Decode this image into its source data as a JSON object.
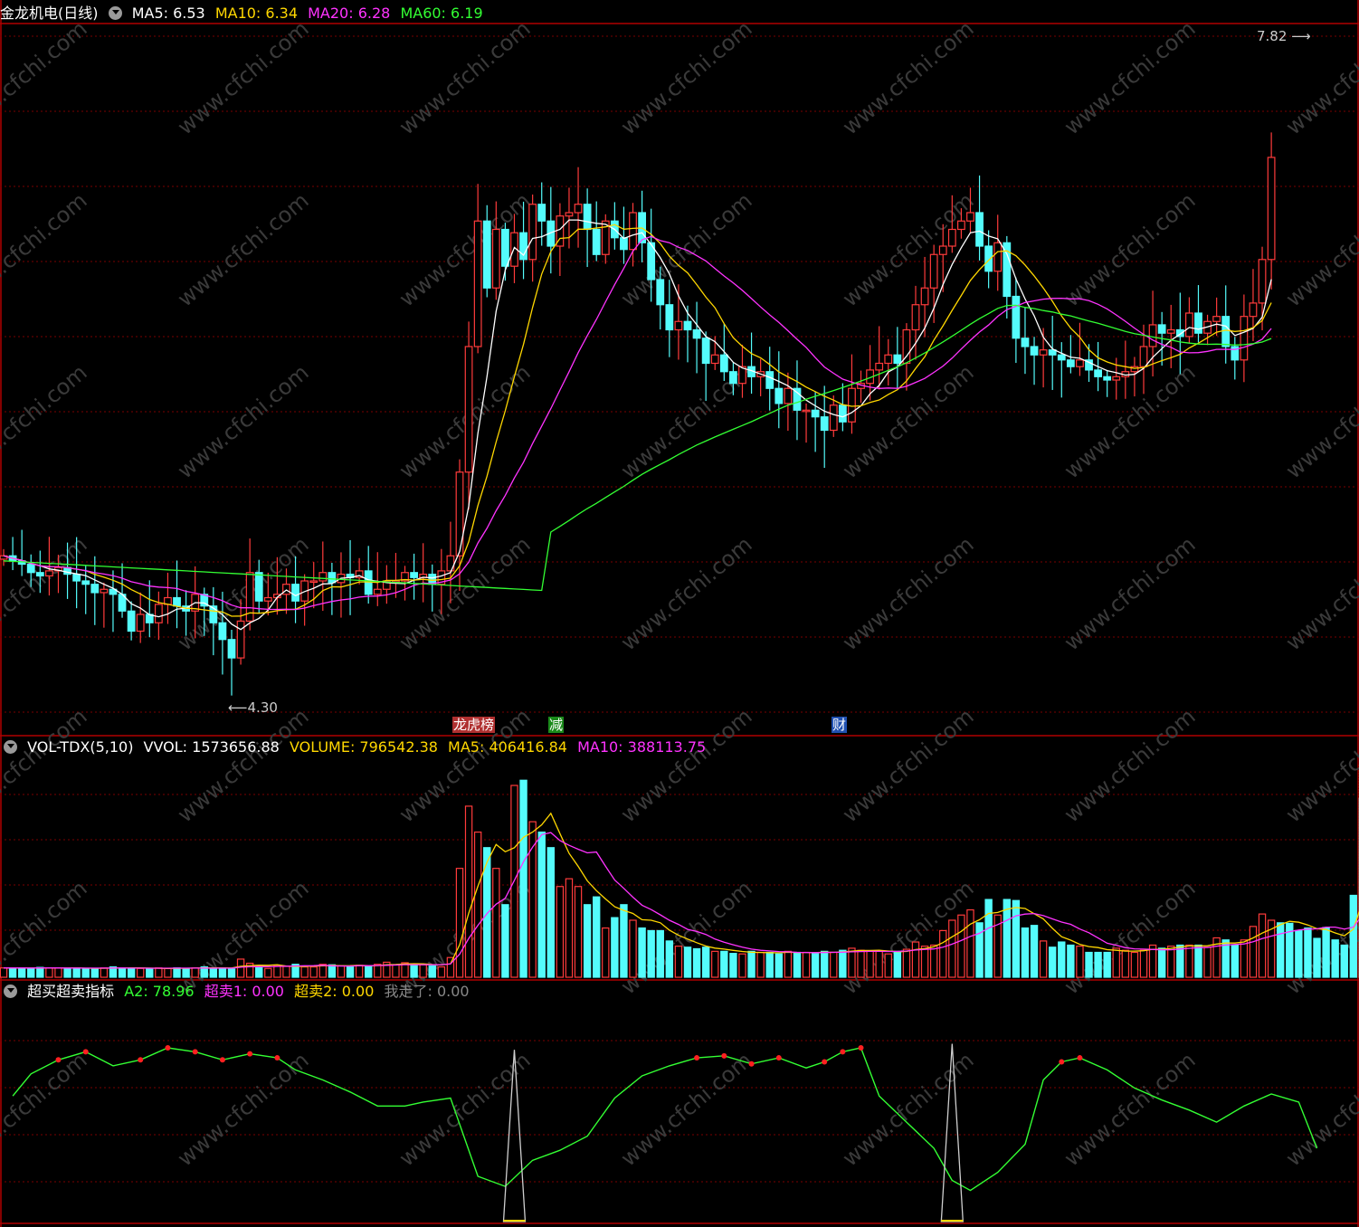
{
  "header": {
    "stock_name": "金龙机电(日线)",
    "ma_labels": [
      {
        "text": "MA5: 6.53",
        "color": "#ffffff"
      },
      {
        "text": "MA10: 6.34",
        "color": "#ffd700"
      },
      {
        "text": "MA20: 6.28",
        "color": "#ff33ff"
      },
      {
        "text": "MA60: 6.19",
        "color": "#33ff33"
      }
    ]
  },
  "price_annotations": {
    "high": "7.82",
    "low": "4.30"
  },
  "event_tags": [
    {
      "text": "龙虎榜",
      "color": "#b03030"
    },
    {
      "text": "减",
      "color": "#1a8a1a"
    },
    {
      "text": "财",
      "color": "#2050b0"
    }
  ],
  "volume_header": {
    "title": "VOL-TDX(5,10)",
    "values": [
      {
        "text": "VVOL: 1573656.88",
        "color": "#ffffff"
      },
      {
        "text": "VOLUME: 796542.38",
        "color": "#ffd700"
      },
      {
        "text": "MA5: 406416.84",
        "color": "#ffd700"
      },
      {
        "text": "MA10: 388113.75",
        "color": "#ff33ff"
      }
    ]
  },
  "indicator_header": {
    "title": "超买超卖指标",
    "values": [
      {
        "text": "A2: 78.96",
        "color": "#33ff33"
      },
      {
        "text": "超卖1: 0.00",
        "color": "#ff33ff"
      },
      {
        "text": "超卖2: 0.00",
        "color": "#ffd700"
      },
      {
        "text": "我走了: 0.00",
        "color": "#888888"
      }
    ]
  },
  "colors": {
    "up": "#ff3b3b",
    "down": "#54fcfc",
    "ma5": "#ffffff",
    "ma10": "#ffd700",
    "ma20": "#ff33ff",
    "ma60": "#33ff33",
    "grid": "#7a0000",
    "border": "#b00000"
  },
  "chart_data": {
    "type": "candlestick",
    "ylim": [
      4.0,
      8.0
    ],
    "closes": [
      4.95,
      4.92,
      4.9,
      4.85,
      4.83,
      4.86,
      4.88,
      4.84,
      4.8,
      4.78,
      4.73,
      4.75,
      4.72,
      4.62,
      4.5,
      4.6,
      4.55,
      4.66,
      4.7,
      4.65,
      4.62,
      4.72,
      4.65,
      4.55,
      4.45,
      4.34,
      4.56,
      4.85,
      4.68,
      4.7,
      4.72,
      4.78,
      4.68,
      4.8,
      4.8,
      4.85,
      4.79,
      4.84,
      4.82,
      4.86,
      4.72,
      4.75,
      4.8,
      4.8,
      4.85,
      4.82,
      4.84,
      4.78,
      4.86,
      4.95,
      5.45,
      6.2,
      6.95,
      6.55,
      6.9,
      6.68,
      6.88,
      6.72,
      7.05,
      6.95,
      6.8,
      6.98,
      7.0,
      7.05,
      6.9,
      6.75,
      6.95,
      6.85,
      6.78,
      7.0,
      6.82,
      6.6,
      6.45,
      6.3,
      6.35,
      6.3,
      6.25,
      6.1,
      6.15,
      6.05,
      5.98,
      6.08,
      6.02,
      6.05,
      5.95,
      5.86,
      5.95,
      5.82,
      5.82,
      5.78,
      5.7,
      5.85,
      5.75,
      5.95,
      5.98,
      6.06,
      6.1,
      6.15,
      6.1,
      6.3,
      6.45,
      6.55,
      6.75,
      6.8,
      6.9,
      6.95,
      7.0,
      6.8,
      6.65,
      6.82,
      6.5,
      6.25,
      6.2,
      6.15,
      6.18,
      6.15,
      6.12,
      6.08,
      6.12,
      6.06,
      6.02,
      6.0,
      6.02,
      6.05,
      6.08,
      6.2,
      6.33,
      6.28,
      6.3,
      6.26,
      6.4,
      6.28,
      6.35,
      6.38,
      6.2,
      6.12,
      6.38,
      6.46,
      6.72,
      7.33
    ],
    "volumes": [
      18,
      18,
      18,
      17,
      19,
      18,
      18,
      17,
      18,
      16,
      17,
      18,
      20,
      18,
      17,
      17,
      16,
      18,
      17,
      18,
      17,
      18,
      20,
      17,
      18,
      16,
      35,
      27,
      20,
      17,
      22,
      21,
      25,
      20,
      20,
      25,
      24,
      22,
      21,
      23,
      22,
      25,
      29,
      24,
      28,
      25,
      24,
      22,
      20,
      38,
      210,
      330,
      280,
      250,
      210,
      140,
      370,
      380,
      300,
      280,
      250,
      175,
      190,
      175,
      140,
      155,
      95,
      115,
      140,
      110,
      95,
      90,
      90,
      70,
      60,
      58,
      55,
      58,
      50,
      50,
      46,
      45,
      50,
      48,
      48,
      45,
      50,
      48,
      48,
      46,
      50,
      48,
      52,
      56,
      52,
      50,
      50,
      45,
      50,
      54,
      68,
      60,
      62,
      90,
      110,
      120,
      130,
      105,
      150,
      120,
      150,
      148,
      95,
      100,
      70,
      58,
      68,
      62,
      60,
      48,
      48,
      48,
      56,
      52,
      48,
      52,
      62,
      56,
      60,
      62,
      62,
      62,
      58,
      76,
      72,
      62,
      72,
      98,
      122,
      110,
      105,
      104,
      90,
      95,
      75,
      96,
      72,
      62,
      158,
      345
    ],
    "oscillator": [
      [
        1,
        0.58
      ],
      [
        3,
        0.69
      ],
      [
        6,
        0.76
      ],
      [
        9,
        0.8
      ],
      [
        12,
        0.73
      ],
      [
        15,
        0.76
      ],
      [
        18,
        0.82
      ],
      [
        21,
        0.8
      ],
      [
        24,
        0.76
      ],
      [
        27,
        0.79
      ],
      [
        30,
        0.77
      ],
      [
        32,
        0.71
      ],
      [
        35,
        0.66
      ],
      [
        38,
        0.6
      ],
      [
        41,
        0.53
      ],
      [
        44,
        0.53
      ],
      [
        46,
        0.55
      ],
      [
        49,
        0.57
      ],
      [
        52,
        0.18
      ],
      [
        55,
        0.13
      ],
      [
        58,
        0.26
      ],
      [
        61,
        0.31
      ],
      [
        64,
        0.38
      ],
      [
        67,
        0.57
      ],
      [
        70,
        0.68
      ],
      [
        73,
        0.73
      ],
      [
        76,
        0.77
      ],
      [
        79,
        0.78
      ],
      [
        82,
        0.74
      ],
      [
        85,
        0.77
      ],
      [
        88,
        0.72
      ],
      [
        90,
        0.75
      ],
      [
        92,
        0.8
      ],
      [
        94,
        0.82
      ],
      [
        96,
        0.58
      ],
      [
        99,
        0.45
      ],
      [
        102,
        0.32
      ],
      [
        104,
        0.16
      ],
      [
        106,
        0.11
      ],
      [
        109,
        0.2
      ],
      [
        112,
        0.34
      ],
      [
        114,
        0.66
      ],
      [
        116,
        0.75
      ],
      [
        118,
        0.77
      ],
      [
        121,
        0.71
      ],
      [
        124,
        0.62
      ],
      [
        127,
        0.56
      ],
      [
        130,
        0.51
      ],
      [
        133,
        0.45
      ],
      [
        136,
        0.53
      ],
      [
        139,
        0.59
      ],
      [
        142,
        0.55
      ],
      [
        144,
        0.32
      ]
    ]
  }
}
